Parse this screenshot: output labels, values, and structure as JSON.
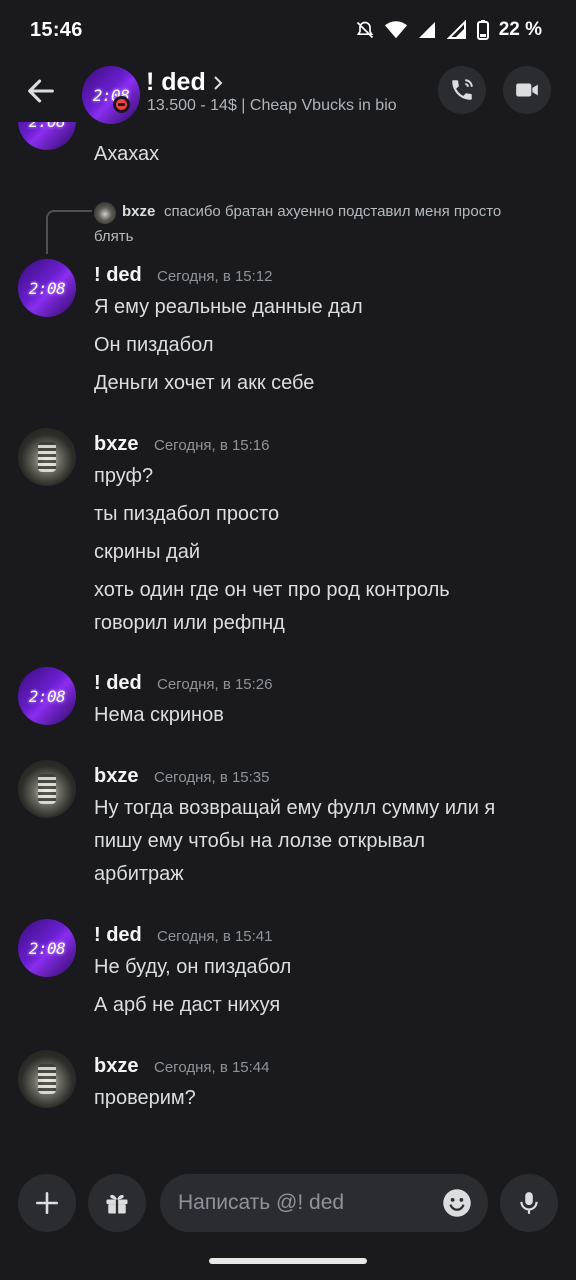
{
  "status_bar": {
    "time": "15:46",
    "battery": "22 %"
  },
  "header": {
    "title": "! ded",
    "subtitle": "13.500 - 14$ | Cheap Vbucks in bio",
    "avatar_text": "2:08"
  },
  "messages": {
    "partial": {
      "text": "Ахахах"
    },
    "reply": {
      "name": "bxze",
      "text_line1": "спасибо братан ахуенно подставил меня просто",
      "text_line2": "блять"
    },
    "groups": [
      {
        "author": "! ded",
        "time": "Сегодня, в 15:12",
        "lines": [
          "Я ему реальные данные дал",
          "Он пиздабол",
          "Деньги хочет и акк себе"
        ]
      },
      {
        "author": "bxze",
        "time": "Сегодня, в 15:16",
        "lines": [
          "пруф?",
          "ты пиздабол просто",
          "скрины дай",
          "хоть один где он чет про род контроль",
          "говорил или рефпнд"
        ]
      },
      {
        "author": "! ded",
        "time": "Сегодня, в 15:26",
        "lines": [
          "Нема скринов"
        ]
      },
      {
        "author": "bxze",
        "time": "Сегодня, в 15:35",
        "lines": [
          "Ну тогда возвращай ему фулл сумму или я",
          "пишу ему чтобы на лолзе открывал",
          "арбитраж"
        ]
      },
      {
        "author": "! ded",
        "time": "Сегодня, в 15:41",
        "lines": [
          "Не буду, он пиздабол",
          "А арб не даст нихуя"
        ]
      },
      {
        "author": "bxze",
        "time": "Сегодня, в 15:44",
        "lines": [
          "проверим?"
        ]
      }
    ]
  },
  "input": {
    "placeholder": "Написать @! ded"
  },
  "icons": {
    "back": "arrow-left-icon",
    "call": "phone-icon",
    "video": "video-camera-icon",
    "add": "plus-icon",
    "gift": "gift-icon",
    "emoji": "emoji-icon",
    "mic": "microphone-icon"
  },
  "colors": {
    "background": "#1a1a1e",
    "surface": "#2b2c31",
    "dnd": "#f23f43",
    "accent": "#6a1fd0"
  }
}
